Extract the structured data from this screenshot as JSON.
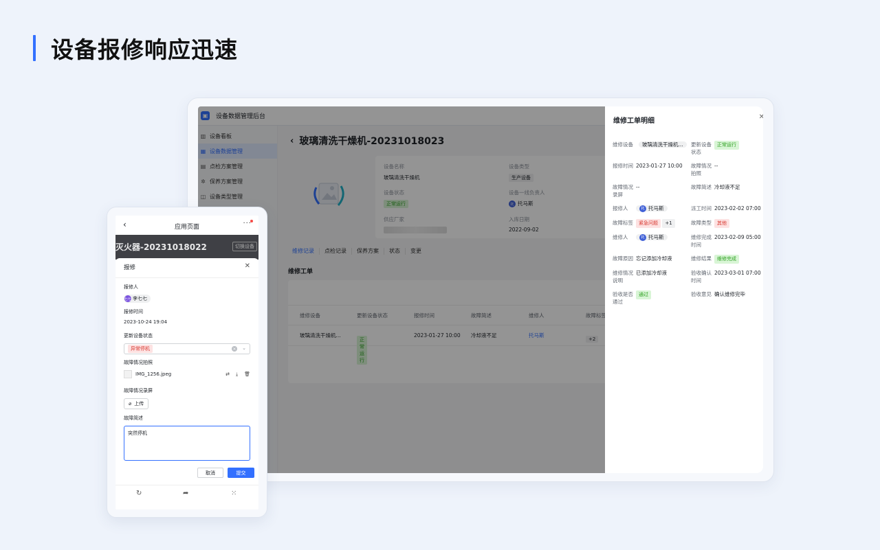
{
  "heading": "设备报修响应迅速",
  "desktop": {
    "app_title": "设备数据管理后台",
    "sidebar": [
      {
        "label": "设备看板",
        "icon": "chart-icon"
      },
      {
        "label": "设备数据管理",
        "icon": "grid-icon",
        "active": true
      },
      {
        "label": "点检方案管理",
        "icon": "calendar-icon"
      },
      {
        "label": "保养方案管理",
        "icon": "wrench-icon"
      },
      {
        "label": "设备类型管理",
        "icon": "box-icon"
      }
    ],
    "device_title": "玻璃清洗干燥机-20231018023",
    "info": {
      "name_label": "设备名称",
      "name_value": "玻璃清洗干燥机",
      "type_label": "设备类型",
      "type_value": "生产设备",
      "status_label": "设备状态",
      "status_value": "正常运行",
      "owner_label": "设备一线负责人",
      "owner_value": "托马斯",
      "supplier_label": "供应厂家",
      "date_label": "入库日期",
      "date_value": "2022-09-02"
    },
    "tabs": [
      "维修记录",
      "点检记录",
      "保养方案",
      "状态",
      "变更"
    ],
    "section_title": "维修工单",
    "table": {
      "headers": [
        "维修设备",
        "更新设备状态",
        "报修时间",
        "故障简述",
        "维修人",
        "故障标签"
      ],
      "row": {
        "device": "玻璃清洗干燥机...",
        "status": "正常运行",
        "time": "2023-01-27 10:00",
        "desc": "冷却液不足",
        "repairer": "托马斯",
        "tags": "+2"
      }
    }
  },
  "drawer": {
    "title": "维修工单明细",
    "fields": {
      "device_label": "维修设备",
      "device_value": "玻璃清洗干燥机...",
      "update_label": "更新设备状态",
      "update_value": "正常运行",
      "report_time_label": "报修时间",
      "report_time_value": "2023-01-27 10:00",
      "photo_label": "故障情况拍照",
      "photo_value": "--",
      "record_label": "故障情况录屏",
      "record_value": "--",
      "brief_label": "故障简述",
      "brief_value": "冷却液不足",
      "reporter_label": "报修人",
      "reporter_value": "托马斯",
      "dispatch_label": "派工时间",
      "dispatch_value": "2023-02-02 07:00",
      "tags_label": "故障标签",
      "tags_value": "紧急问题",
      "tags_more": "+1",
      "fault_type_label": "故障类型",
      "fault_type_value": "其他",
      "repairer_label": "维修人",
      "repairer_value": "托马斯",
      "done_time_label": "维修完成时间",
      "done_time_value": "2023-02-09 05:00",
      "reason_label": "故障原因",
      "reason_value": "忘记添加冷却液",
      "result_label": "维修结果",
      "result_value": "维修完成",
      "explain_label": "维修情况说明",
      "explain_value": "已添加冷却液",
      "confirm_time_label": "验收确认时间",
      "confirm_time_value": "2023-03-01 07:00",
      "pass_label": "验收是否通过",
      "pass_value": "通过",
      "opinion_label": "验收意见",
      "opinion_value": "确认维修完毕"
    },
    "avatar_text": "托"
  },
  "mobile": {
    "nav_title": "应用页面",
    "device_title": "灭火器-20231018022",
    "switch_label": "切换设备",
    "sheet_title": "报修",
    "reporter_label": "报修人",
    "reporter_value": "李七七",
    "reporter_avatar": "七七",
    "time_label": "报修时间",
    "time_value": "2023-10-24 19:04",
    "status_label": "更新设备状态",
    "status_value": "异常停机",
    "photo_label": "故障情况拍照",
    "photo_file": "IMG_1256.jpeg",
    "record_label": "故障情况录屏",
    "upload_label": "上传",
    "brief_label": "故障简述",
    "brief_value": "突然停机",
    "cancel_label": "取消",
    "submit_label": "提交"
  },
  "colors": {
    "accent": "#3370ff",
    "success": "#2ea121",
    "danger": "#d83931"
  }
}
